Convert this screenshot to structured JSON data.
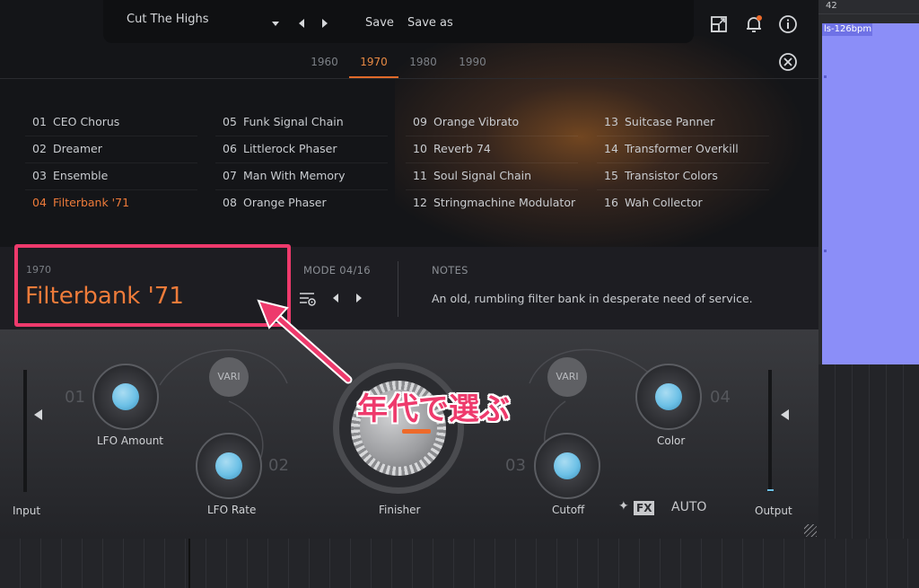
{
  "daw": {
    "ruler_number": "42",
    "clip_label": "ls-126bpm"
  },
  "topbar": {
    "preset_name": "Cut The Highs",
    "save_label": "Save",
    "save_as_label": "Save as"
  },
  "tabs": [
    {
      "label": "1960",
      "active": false
    },
    {
      "label": "1970",
      "active": true
    },
    {
      "label": "1980",
      "active": false
    },
    {
      "label": "1990",
      "active": false
    }
  ],
  "presets": {
    "col1": [
      {
        "num": "01",
        "name": "CEO Chorus"
      },
      {
        "num": "02",
        "name": "Dreamer"
      },
      {
        "num": "03",
        "name": "Ensemble"
      },
      {
        "num": "04",
        "name": "Filterbank '71"
      }
    ],
    "col2": [
      {
        "num": "05",
        "name": "Funk Signal Chain"
      },
      {
        "num": "06",
        "name": "Littlerock Phaser"
      },
      {
        "num": "07",
        "name": "Man With Memory"
      },
      {
        "num": "08",
        "name": "Orange Phaser"
      }
    ],
    "col3": [
      {
        "num": "09",
        "name": "Orange Vibrato"
      },
      {
        "num": "10",
        "name": "Reverb 74"
      },
      {
        "num": "11",
        "name": "Soul Signal Chain"
      },
      {
        "num": "12",
        "name": "Stringmachine Modulator"
      }
    ],
    "col4": [
      {
        "num": "13",
        "name": "Suitcase Panner"
      },
      {
        "num": "14",
        "name": "Transformer Overkill"
      },
      {
        "num": "15",
        "name": "Transistor Colors"
      },
      {
        "num": "16",
        "name": "Wah Collector"
      }
    ]
  },
  "info": {
    "decade": "1970",
    "title": "Filterbank '71",
    "mode_label": "MODE 04/16",
    "notes_label": "NOTES",
    "notes_text": "An old, rumbling filter bank in desperate need of service."
  },
  "controls": {
    "input_label": "Input",
    "output_label": "Output",
    "lfo_amount_label": "LFO Amount",
    "lfo_rate_label": "LFO Rate",
    "finisher_label": "Finisher",
    "cutoff_label": "Cutoff",
    "color_label": "Color",
    "vari_left": "VARI",
    "vari_right": "VARI",
    "num_01": "01",
    "num_02": "02",
    "num_03": "03",
    "num_04": "04",
    "fx_logo": "FX",
    "fx_auto": "AUTO"
  },
  "annotation": {
    "text": "年代で選ぶ",
    "color": "#ee3a6c"
  },
  "colors": {
    "accent_orange": "#ee7b3a",
    "knob_blue": "#6cc0e6",
    "daw_clip": "#8b8ef8"
  }
}
